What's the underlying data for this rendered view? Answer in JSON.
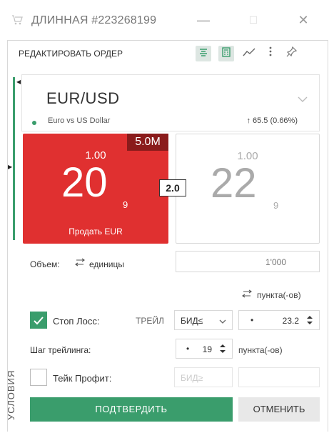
{
  "window": {
    "title": "ДЛИННАЯ #223268199",
    "minimize_glyph": "—",
    "maximize_glyph": "☐",
    "close_glyph": "✕"
  },
  "toolbar": {
    "label": "РЕДАКТИРОВАТЬ ОРДЕР",
    "icons": [
      "order-ticket-icon",
      "calculator-icon",
      "chart-icon",
      "more-icon",
      "pin-icon"
    ]
  },
  "instrument": {
    "symbol": "EUR/USD",
    "description": "Euro vs US Dollar",
    "change": "65.5 (0.66%)",
    "change_arrow": "↑"
  },
  "sell": {
    "badge": "5.0M",
    "big_figure": "1.00",
    "pips": "20",
    "pipette": "9",
    "caption": "Продать EUR",
    "color": "#e03030"
  },
  "spread": "2.0",
  "buy": {
    "big_figure": "1.00",
    "pips": "22",
    "pipette": "9"
  },
  "volume": {
    "label": "Объем:",
    "unit_label": "единицы",
    "value": "1'000"
  },
  "points_header": "пункта(-ов)",
  "stop_loss": {
    "label": "Стоп Лосс:",
    "checked": true,
    "trail_label": "ТРЕЙЛ",
    "select_value": "БИД≤",
    "dot": "•",
    "value": "23.2"
  },
  "trailing_step": {
    "label": "Шаг трейлинга:",
    "dot": "•",
    "value": "19",
    "unit": "пункта(-ов)"
  },
  "take_profit": {
    "label": "Тейк Профит:",
    "checked": false,
    "select_placeholder": "БИД≥"
  },
  "side_label": "УСЛОВИЯ",
  "buttons": {
    "confirm": "ПОДТВЕРДИТЬ",
    "cancel": "ОТМЕНИТЬ"
  },
  "colors": {
    "accent": "#3a9d6c",
    "sell": "#e03030",
    "badge": "#8a1b1b"
  }
}
